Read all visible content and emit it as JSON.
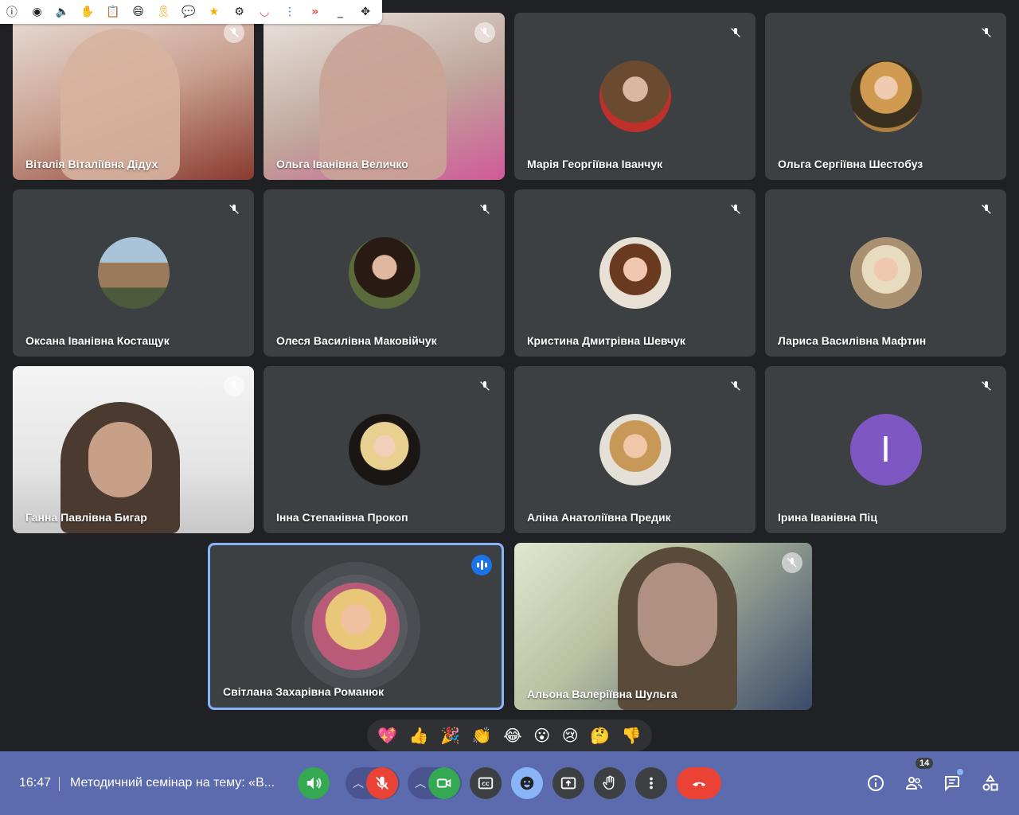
{
  "extension_toolbar": {
    "icons": [
      "info-icon",
      "eye-icon",
      "speaker-icon",
      "hand-icon",
      "clipboard-icon",
      "emoji-icon",
      "ribbon-icon",
      "chat-bubble-icon",
      "star-icon",
      "gear-icon",
      "smile-logo-icon",
      "more-vert-icon",
      "double-chevron-icon",
      "minimize-icon",
      "move-icon"
    ],
    "glyphs": [
      "ⓘ",
      "◉",
      "🔈",
      "✋",
      "📋",
      "😄",
      "🎗",
      "💬",
      "★",
      "⚙",
      "◡",
      "⋮",
      "»",
      "_",
      "✥"
    ]
  },
  "participants": [
    {
      "name": "Віталія Віталіївна Дідух",
      "type": "video",
      "bg": "#b88a78"
    },
    {
      "name": "Ольга Іванівна Величко",
      "type": "video",
      "bg": "#a88a80"
    },
    {
      "name": "Марія Георгіївна Іванчук",
      "type": "avatar",
      "bg": "#5a3a20"
    },
    {
      "name": "Ольга Сергіївна Шестобуз",
      "type": "avatar",
      "bg": "#a06a40"
    },
    {
      "name": "Оксана Іванівна Костащук",
      "type": "avatar",
      "bg": "#8a7a6a"
    },
    {
      "name": "Олеся Василівна Маковійчук",
      "type": "avatar",
      "bg": "#3a2a22"
    },
    {
      "name": "Кристина Дмитрівна Шевчук",
      "type": "avatar",
      "bg": "#c8b090"
    },
    {
      "name": "Лариса Василівна Мафтин",
      "type": "avatar",
      "bg": "#b89a80"
    },
    {
      "name": "Ганна Павлівна Бигар",
      "type": "video",
      "bg": "#c8c8c8"
    },
    {
      "name": "Інна Степанівна Прокоп",
      "type": "avatar",
      "bg": "#2a2220"
    },
    {
      "name": "Аліна Анатоліївна Предик",
      "type": "avatar",
      "bg": "#c8a070"
    },
    {
      "name": "Ірина Іванівна Піц",
      "type": "letter",
      "letter": "I",
      "bg": "#7e57c2"
    },
    {
      "name": "Світлана Захарівна Романюк",
      "type": "speaking",
      "bg": "#d89080"
    },
    {
      "name": "Альона Валеріївна Шульга",
      "type": "video",
      "bg": "#8a8a80"
    }
  ],
  "reactions": [
    "💖",
    "👍",
    "🎉",
    "👏",
    "😂",
    "😮",
    "😢",
    "🤔",
    "👎"
  ],
  "bottom_bar": {
    "time": "16:47",
    "meeting_title": "Методичний семінар на тему: «В...",
    "participant_count": "14"
  },
  "colors": {
    "tile_bg": "#3c4043",
    "speaking_border": "#8ab4f8",
    "bottom_bar": "#5c6bad",
    "leave_button": "#ea4335",
    "active_green": "#34a853",
    "mic_muted_red": "#ea4335",
    "emoji_button": "#8ab4f8"
  }
}
